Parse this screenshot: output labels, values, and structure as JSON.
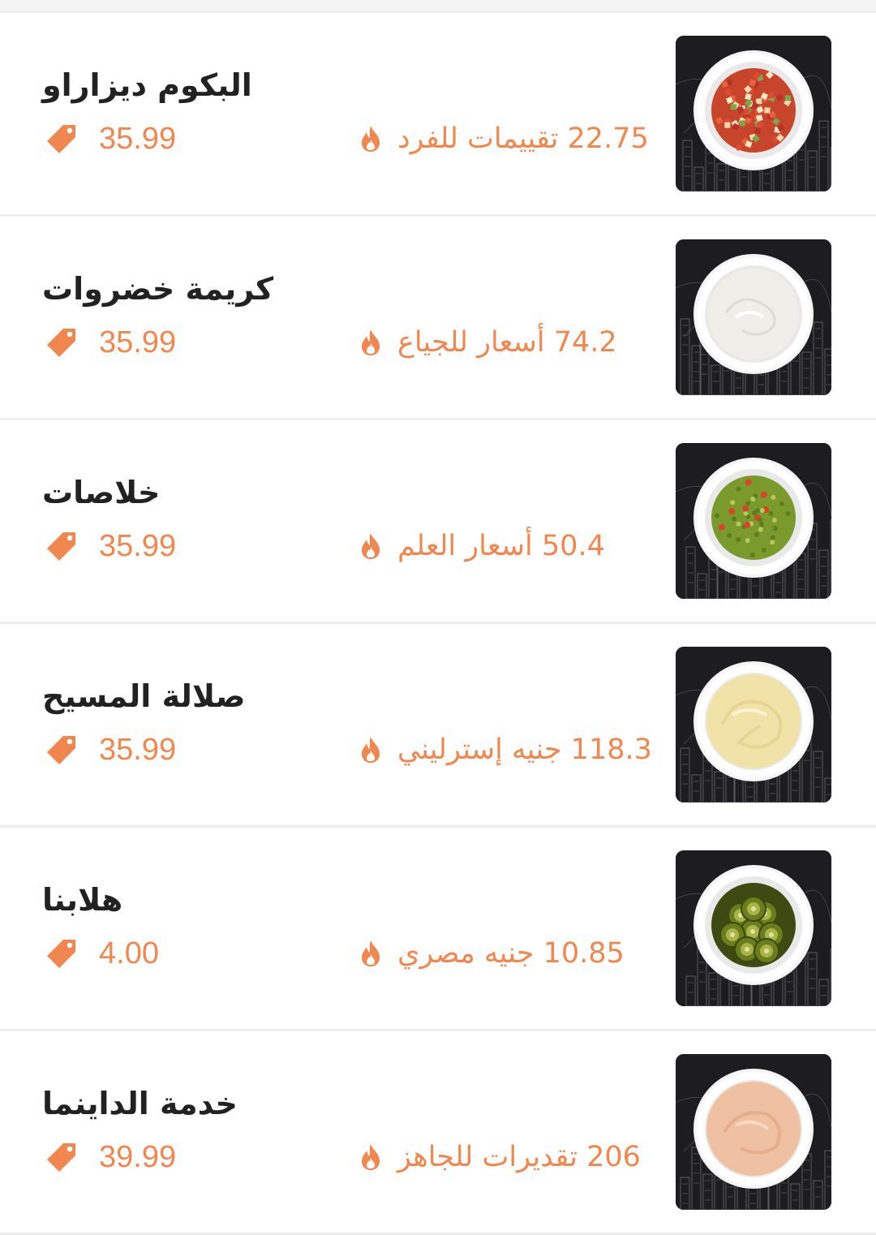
{
  "colors": {
    "accent": "#f0874f",
    "title_text": "#222222",
    "divider": "#eeeeee",
    "image_background": "#1d1d1f"
  },
  "menu": {
    "items": [
      {
        "title": "البكوم ديزاراو",
        "calories": "22.75 تقييمات للفرد",
        "price": "35.99",
        "dish": "tomato-salsa",
        "colors": {
          "bowl_fill": "#c8442a",
          "bowl_accent": "#e9b27a"
        }
      },
      {
        "title": "كريمة خضروات",
        "calories": "74.2 أسعار للجياع",
        "price": "35.99",
        "dish": "sour-cream",
        "colors": {
          "bowl_fill": "#efeee8",
          "bowl_accent": "#d9d8d0"
        }
      },
      {
        "title": "خلاصات",
        "calories": "50.4 أسعار العلم",
        "price": "35.99",
        "dish": "guacamole",
        "colors": {
          "bowl_fill": "#7a9a2c",
          "bowl_accent": "#d8442c"
        }
      },
      {
        "title": "صلالة المسيح",
        "calories": "118.3 جنيه إسترليني",
        "price": "35.99",
        "dish": "cheese-sauce",
        "colors": {
          "bowl_fill": "#f1e3a8",
          "bowl_accent": "#e6d392"
        }
      },
      {
        "title": "هلابنا",
        "calories": "10.85 جنيه مصري",
        "price": "4.00",
        "dish": "jalapenos",
        "colors": {
          "bowl_fill": "#6b7d1e",
          "bowl_accent": "#a9b545"
        }
      },
      {
        "title": "خدمة الداينما",
        "calories": "206 تقديرات للجاهز",
        "price": "39.99",
        "dish": "dynamite-sauce",
        "colors": {
          "bowl_fill": "#f0c0a2",
          "bowl_accent": "#e3a988"
        }
      }
    ]
  }
}
